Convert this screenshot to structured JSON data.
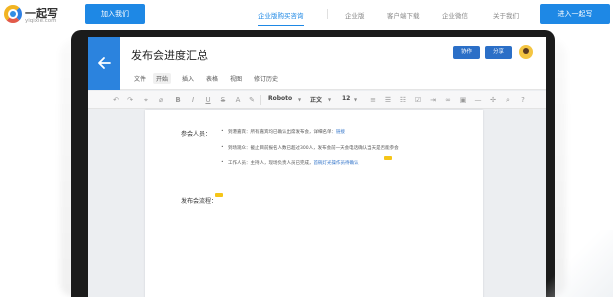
{
  "logo": {
    "name": "一起写",
    "sub": "yiqixie.com"
  },
  "nav": {
    "join_label": "加入我们",
    "items": [
      {
        "label": "企业版购买咨询",
        "active": true
      },
      {
        "label": "企业版",
        "active": false
      },
      {
        "label": "客户端下载",
        "active": false
      },
      {
        "label": "企业微信",
        "active": false
      },
      {
        "label": "关于我们",
        "active": false
      }
    ],
    "enter_label": "进入一起写"
  },
  "doc": {
    "title": "发布会进度汇总",
    "menu": [
      "文件",
      "开始",
      "插入",
      "表格",
      "视图",
      "修订历史"
    ],
    "active_menu": "开始",
    "collab_label": "协作",
    "share_label": "分享"
  },
  "toolbar": {
    "font": "Roboto",
    "style": "正文",
    "size": "12"
  },
  "content": {
    "section1_label": "参会人员：",
    "bullets": [
      {
        "text": "到港嘉宾：所有嘉宾均已确认出席发布会，详细名单：",
        "link": "链接"
      },
      {
        "text": "到场观众：截止目前报名人数已超过300人，发布会前一天会电话确认当天是否能参会",
        "link": ""
      },
      {
        "text": "工作人员：主持人，现场负责人员已完成，",
        "link": "首碗灯光操作员待确认"
      }
    ],
    "section2_label": "发布会流程："
  },
  "colors": {
    "brand_blue": "#1e88e5",
    "doc_blue": "#2b83de",
    "cursor_yellow": "#f5c518"
  }
}
